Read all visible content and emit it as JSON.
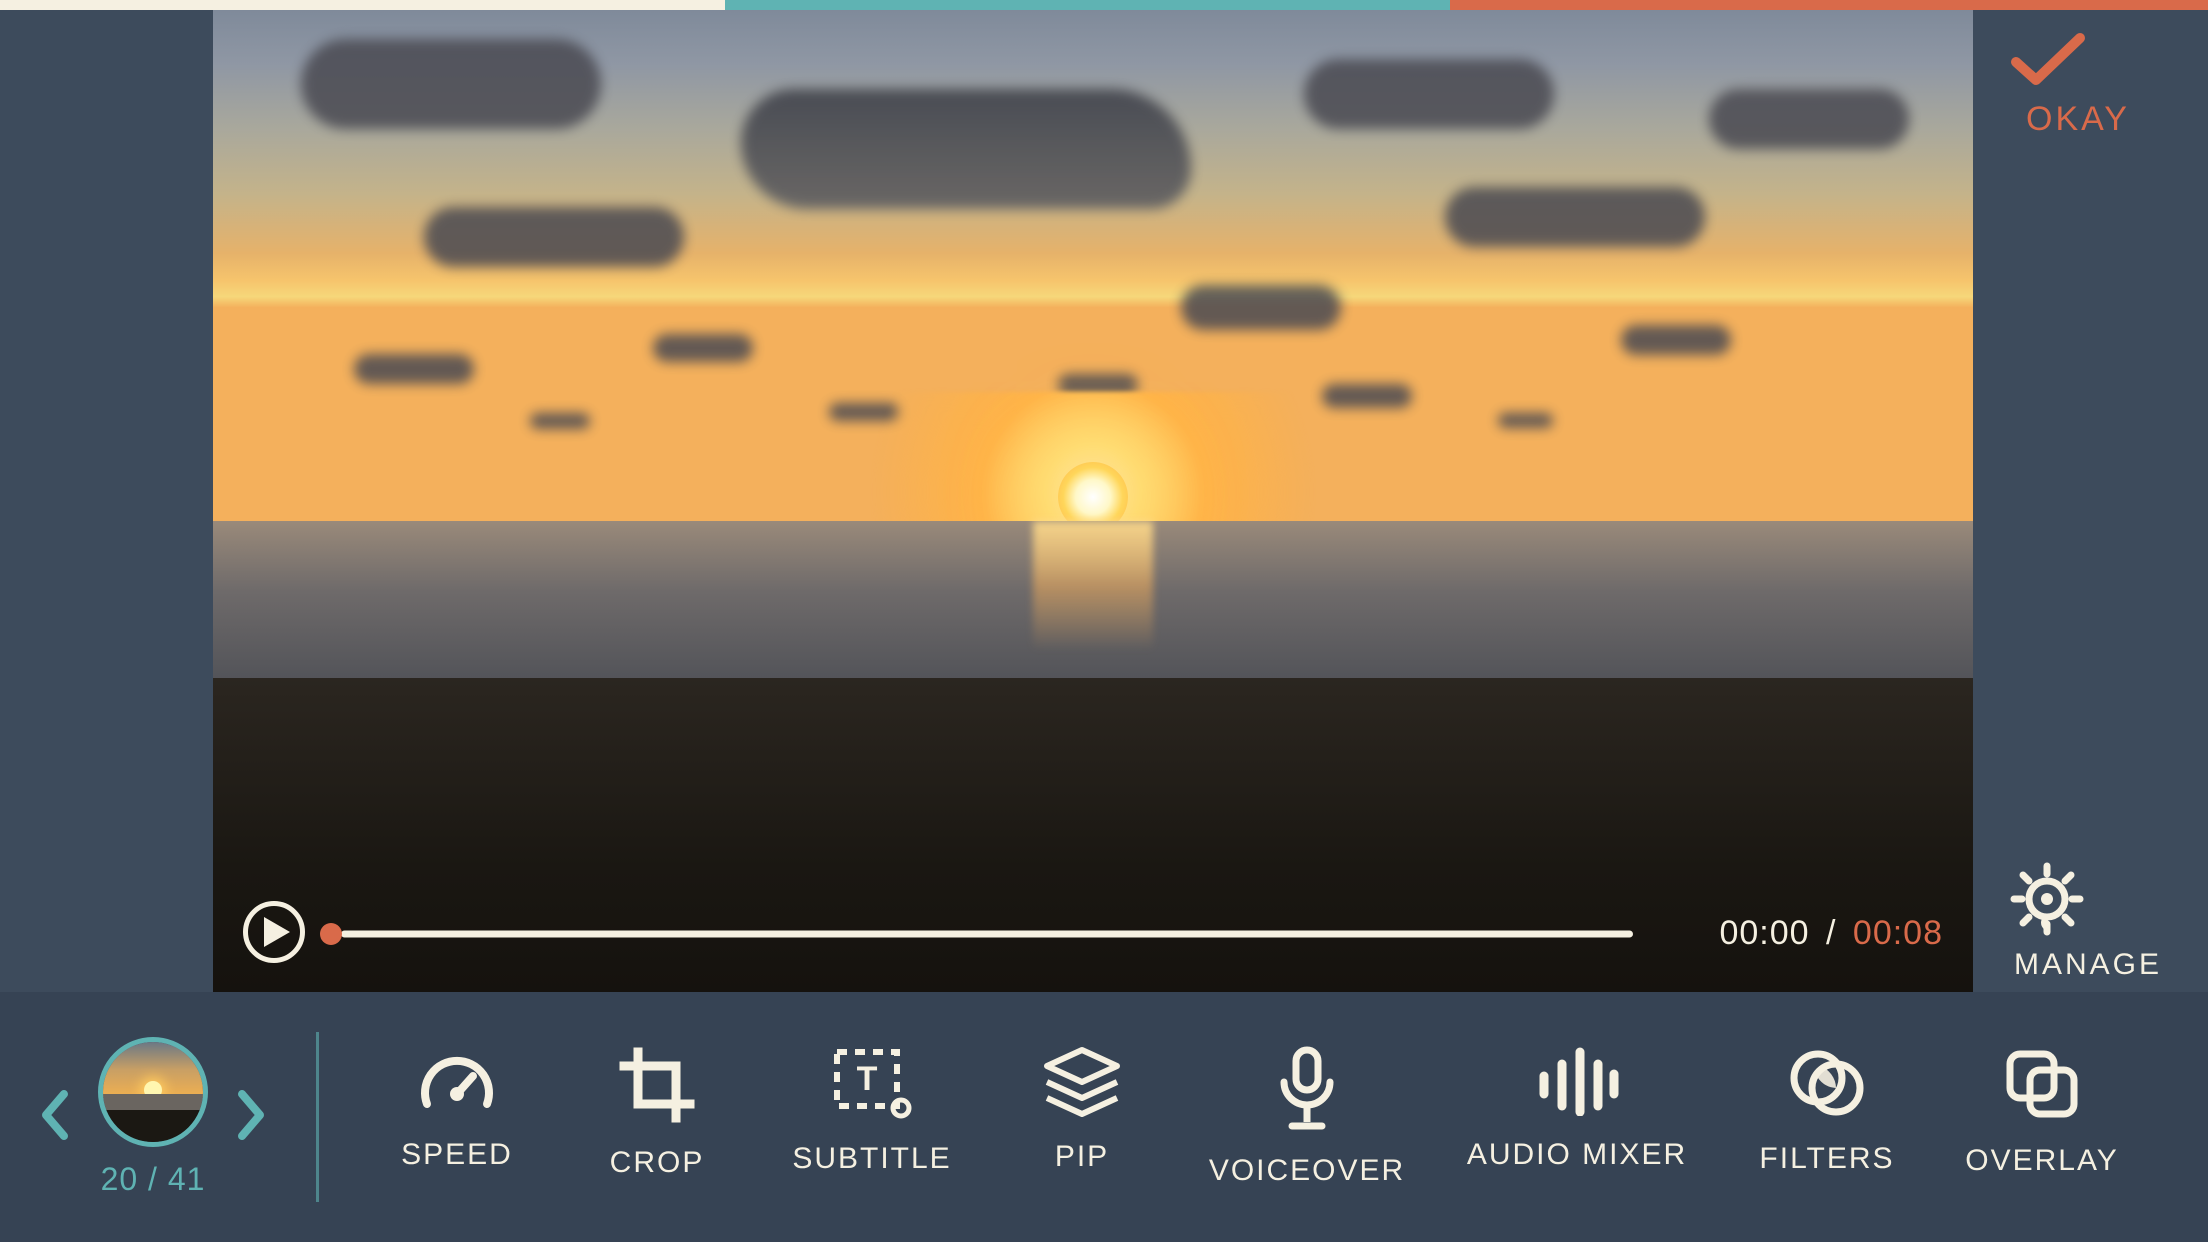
{
  "colors": {
    "accent_teal": "#5fb3b3",
    "accent_orange": "#d96a4a",
    "cream": "#f5f0e1",
    "bg": "#3d4b5c",
    "toolbar_bg": "#364354"
  },
  "playback": {
    "current_time": "00:00",
    "total_time": "00:08",
    "separator": "/"
  },
  "okay": {
    "label": "OKAY"
  },
  "manage": {
    "label": "MANAGE"
  },
  "clip_nav": {
    "current": "20",
    "total": "41",
    "separator": " / "
  },
  "tools": {
    "speed": "SPEED",
    "crop": "CROP",
    "subtitle": "SUBTITLE",
    "pip": "PIP",
    "voiceover": "VOICEOVER",
    "audio_mixer": "AUDIO MIXER",
    "filters": "FILTERS",
    "overlay": "OVERLAY"
  }
}
